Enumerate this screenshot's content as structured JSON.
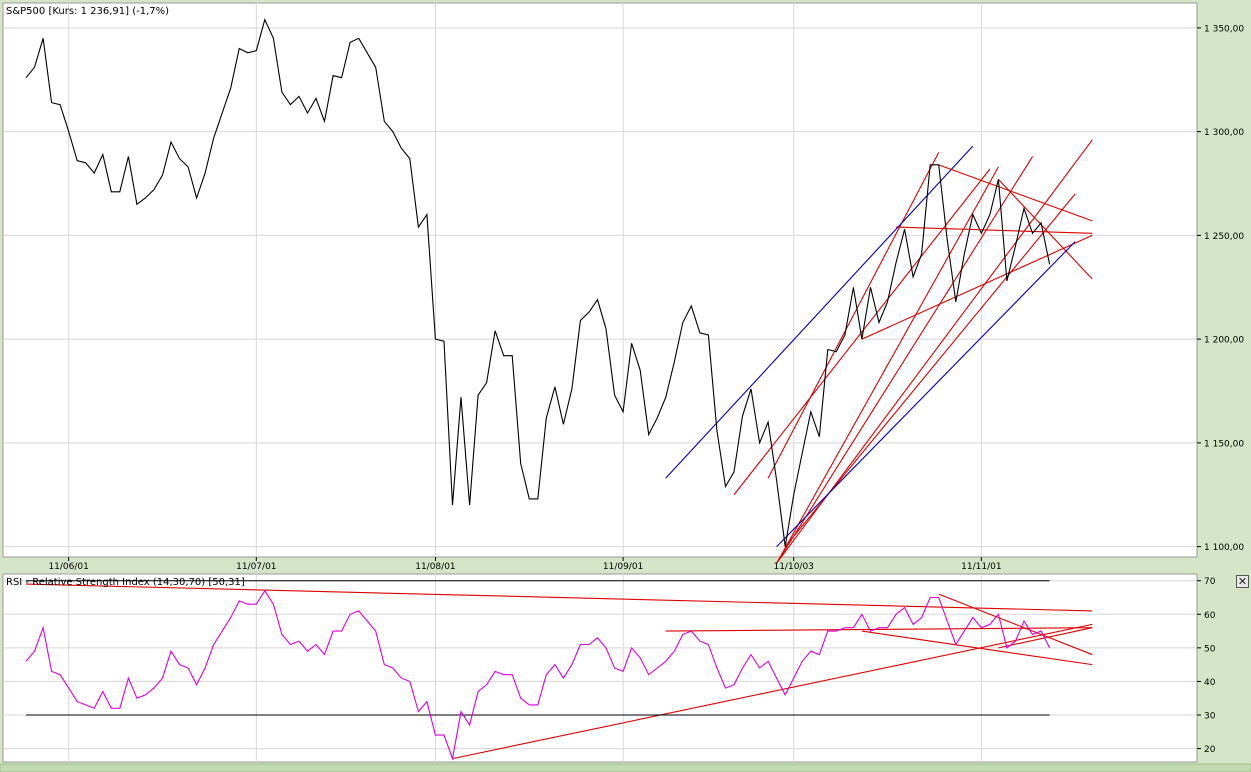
{
  "chart_data": [
    {
      "type": "line",
      "title": "S&P500 [Kurs: 1 236,91] (-1,7%)",
      "ylim": [
        1095,
        1362
      ],
      "y_ticks": [
        {
          "value": 1100,
          "label": "1 100,00"
        },
        {
          "value": 1150,
          "label": "1 150,00"
        },
        {
          "value": 1200,
          "label": "1 200,00"
        },
        {
          "value": 1250,
          "label": "1 250,00"
        },
        {
          "value": 1300,
          "label": "1 300,00"
        },
        {
          "value": 1350,
          "label": "1 350,00"
        }
      ],
      "x_ticks": [
        {
          "index": 5,
          "label": "11/06/01"
        },
        {
          "index": 27,
          "label": "11/07/01"
        },
        {
          "index": 48,
          "label": "11/08/01"
        },
        {
          "index": 70,
          "label": "11/09/01"
        },
        {
          "index": 90,
          "label": "11/10/03"
        },
        {
          "index": 112,
          "label": "11/11/01"
        }
      ],
      "grid": true,
      "series": [
        {
          "color": "#000000",
          "values": [
            1326,
            1331,
            1345,
            1314,
            1313,
            1300,
            1286,
            1285,
            1280,
            1289,
            1271,
            1271,
            1288,
            1265,
            1268,
            1272,
            1279,
            1295,
            1287,
            1283,
            1268,
            1280,
            1297,
            1309,
            1321,
            1340,
            1338,
            1339,
            1354,
            1345,
            1319,
            1313,
            1317,
            1309,
            1316,
            1305,
            1327,
            1326,
            1343,
            1345,
            1338,
            1331,
            1305,
            1300,
            1292,
            1287,
            1254,
            1260,
            1200,
            1199,
            1120,
            1172,
            1120,
            1173,
            1179,
            1204,
            1192,
            1192,
            1140,
            1123,
            1123,
            1162,
            1177,
            1159,
            1176,
            1209,
            1213,
            1219,
            1205,
            1173,
            1165,
            1198,
            1185,
            1154,
            1162,
            1172,
            1189,
            1208,
            1216,
            1203,
            1202,
            1156,
            1129,
            1136,
            1163,
            1176,
            1150,
            1160,
            1132,
            1100,
            1125,
            1145,
            1165,
            1153,
            1195,
            1194,
            1202,
            1225,
            1200,
            1225,
            1208,
            1218,
            1237,
            1253,
            1230,
            1241,
            1284,
            1284,
            1248,
            1218,
            1241,
            1260,
            1251,
            1260,
            1277,
            1228,
            1245,
            1263,
            1251,
            1256,
            1236
          ]
        }
      ],
      "trend_lines": [
        {
          "color": "#dd0000",
          "x1": 87,
          "y1": 1133,
          "x2": 107,
          "y2": 1290
        },
        {
          "color": "#dd0000",
          "x1": 83,
          "y1": 1125,
          "x2": 113,
          "y2": 1282
        },
        {
          "color": "#dd0000",
          "x1": 88,
          "y1": 1092,
          "x2": 114,
          "y2": 1283
        },
        {
          "color": "#dd0000",
          "x1": 88,
          "y1": 1092,
          "x2": 118,
          "y2": 1288
        },
        {
          "color": "#dd0000",
          "x1": 88,
          "y1": 1092,
          "x2": 125,
          "y2": 1296
        },
        {
          "color": "#dd0000",
          "x1": 89,
          "y1": 1100,
          "x2": 123,
          "y2": 1270
        },
        {
          "color": "#dd0000",
          "x1": 98,
          "y1": 1200,
          "x2": 125,
          "y2": 1250
        },
        {
          "color": "#dd0000",
          "x1": 102,
          "y1": 1254,
          "x2": 125,
          "y2": 1251
        },
        {
          "color": "#dd0000",
          "x1": 107,
          "y1": 1284,
          "x2": 125,
          "y2": 1257
        },
        {
          "color": "#dd0000",
          "x1": 114,
          "y1": 1277,
          "x2": 125,
          "y2": 1229
        },
        {
          "color": "#0000bb",
          "x1": 75,
          "y1": 1133,
          "x2": 111,
          "y2": 1293
        },
        {
          "color": "#0000bb",
          "x1": 88,
          "y1": 1100,
          "x2": 123,
          "y2": 1247
        }
      ]
    },
    {
      "type": "line",
      "title": "RSI - Relative Strength Index (14,30,70) [50,31]",
      "ylim": [
        16,
        72
      ],
      "y_ticks": [
        {
          "value": 20,
          "label": "20"
        },
        {
          "value": 30,
          "label": "30"
        },
        {
          "value": 40,
          "label": "40"
        },
        {
          "value": 50,
          "label": "50"
        },
        {
          "value": 60,
          "label": "60"
        },
        {
          "value": 70,
          "label": "70"
        }
      ],
      "grid": true,
      "reference_levels": [
        30,
        70
      ],
      "series": [
        {
          "color": "#dd00dd",
          "values": [
            46,
            49,
            56,
            43,
            42,
            38,
            34,
            33,
            32,
            37,
            32,
            32,
            41,
            35,
            36,
            38,
            41,
            49,
            45,
            44,
            39,
            44,
            51,
            55,
            59,
            64,
            63,
            63,
            67,
            63,
            54,
            51,
            52,
            49,
            51,
            48,
            55,
            55,
            60,
            61,
            58,
            55,
            45,
            44,
            41,
            40,
            31,
            34,
            24,
            24,
            17,
            31,
            27,
            37,
            39,
            43,
            42,
            42,
            35,
            33,
            33,
            42,
            45,
            41,
            45,
            51,
            51,
            53,
            50,
            44,
            43,
            50,
            47,
            42,
            44,
            46,
            49,
            54,
            55,
            52,
            51,
            44,
            38,
            39,
            44,
            48,
            44,
            46,
            41,
            36,
            41,
            46,
            49,
            48,
            55,
            55,
            56,
            56,
            60,
            55,
            56,
            56,
            60,
            62,
            57,
            59,
            65,
            65,
            58,
            51,
            55,
            59,
            56,
            57,
            60,
            50,
            52,
            58,
            54,
            55,
            50
          ]
        }
      ],
      "trend_lines": [
        {
          "color": "#dd0000",
          "x1": 0,
          "y1": 69,
          "x2": 125,
          "y2": 61
        },
        {
          "color": "#dd0000",
          "x1": 75,
          "y1": 55,
          "x2": 125,
          "y2": 56
        },
        {
          "color": "#dd0000",
          "x1": 98,
          "y1": 55,
          "x2": 125,
          "y2": 45
        },
        {
          "color": "#dd0000",
          "x1": 107,
          "y1": 66,
          "x2": 125,
          "y2": 48
        },
        {
          "color": "#dd0000",
          "x1": 50,
          "y1": 17,
          "x2": 125,
          "y2": 57
        },
        {
          "color": "#dd0000",
          "x1": 114,
          "y1": 50,
          "x2": 125,
          "y2": 56
        }
      ]
    }
  ],
  "ui": {
    "close_symbol": "✕"
  }
}
